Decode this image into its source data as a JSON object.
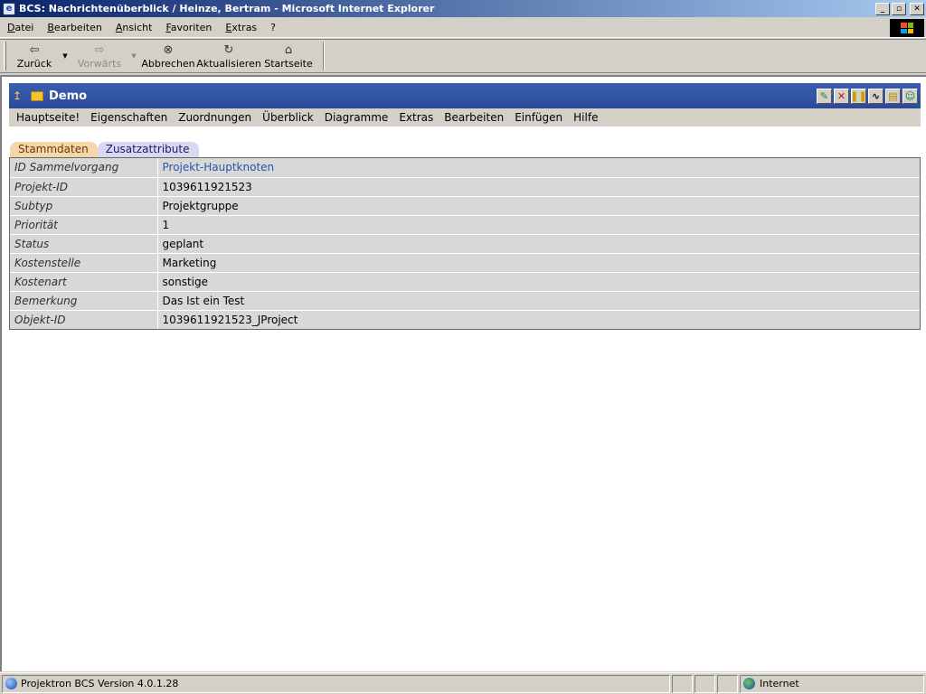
{
  "window": {
    "title": "BCS: Nachrichtenüberblick / Heinze, Bertram - Microsoft Internet Explorer",
    "controls": [
      "_",
      "▫",
      "✕"
    ]
  },
  "menubar": {
    "items": [
      "Datei",
      "Bearbeiten",
      "Ansicht",
      "Favoriten",
      "Extras",
      "?"
    ]
  },
  "toolbar": {
    "back": "Zurück",
    "forward": "Vorwärts",
    "stop": "Abbrechen",
    "refresh": "Aktualisieren",
    "home": "Startseite"
  },
  "page": {
    "title": "Demo",
    "header_buttons": [
      "edit-icon",
      "delete-icon",
      "columns-icon",
      "graph-icon",
      "note-icon",
      "user-icon"
    ],
    "menu": [
      "Hauptseite!",
      "Eigenschaften",
      "Zuordnungen",
      "Überblick",
      "Diagramme",
      "Extras",
      "Bearbeiten",
      "Einfügen",
      "Hilfe"
    ],
    "tabs": [
      "Stammdaten",
      "Zusatzattribute"
    ],
    "active_tab": "Stammdaten",
    "fields": [
      {
        "label": "ID Sammelvorgang",
        "value": "Projekt-Hauptknoten"
      },
      {
        "label": "Projekt-ID",
        "value": "1039611921523"
      },
      {
        "label": "Subtyp",
        "value": "Projektgruppe"
      },
      {
        "label": "Priorität",
        "value": "1"
      },
      {
        "label": "Status",
        "value": "geplant"
      },
      {
        "label": "Kostenstelle",
        "value": "Marketing"
      },
      {
        "label": "Kostenart",
        "value": "sonstige"
      },
      {
        "label": "Bemerkung",
        "value": "Das Ist ein Test"
      },
      {
        "label": "Objekt-ID",
        "value": "1039611921523_JProject"
      }
    ]
  },
  "statusbar": {
    "text": "Projektron BCS Version 4.0.1.28",
    "zone": "Internet"
  },
  "colors": {
    "header_blue": "#2a4a98",
    "link": "#2a56a8",
    "tab_active": "#f5d6a8",
    "tab_inactive": "#d8d8f0"
  }
}
